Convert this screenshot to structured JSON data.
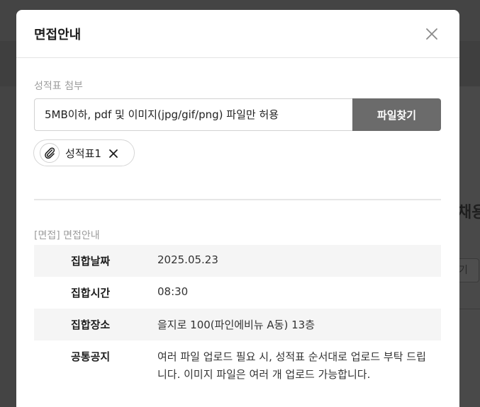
{
  "modal": {
    "title": "면접안내",
    "close_icon": "close-icon"
  },
  "attachment": {
    "section_label": "성적표 첨부",
    "input_placeholder": "5MB이하, pdf 및 이미지(jpg/gif/png) 파일만 허용",
    "button_label": "파일찾기",
    "files": [
      {
        "name": "성적표1",
        "icon": "paperclip-icon",
        "remove_icon": "close-icon"
      }
    ]
  },
  "interview": {
    "section_label": "[면접] 면접안내",
    "rows": [
      {
        "label": "집합날짜",
        "value": "2025.05.23"
      },
      {
        "label": "집합시간",
        "value": "08:30"
      },
      {
        "label": "집합장소",
        "value": "을지로 100(파인에비뉴 A동) 13층"
      },
      {
        "label": "공통공지",
        "value": "여러 파일 업로드 필요 시, 성적표 순서대로 업로드 부탁 드립니다. 이미지 파일은 여러 개 업로드 가능합니다."
      }
    ]
  },
  "background": {
    "heading_fragment": "채용",
    "button_fragment": "기"
  },
  "colors": {
    "overlay": "#444444",
    "button_bg": "#6b6b6b",
    "row_shade": "#f5f5f5"
  }
}
